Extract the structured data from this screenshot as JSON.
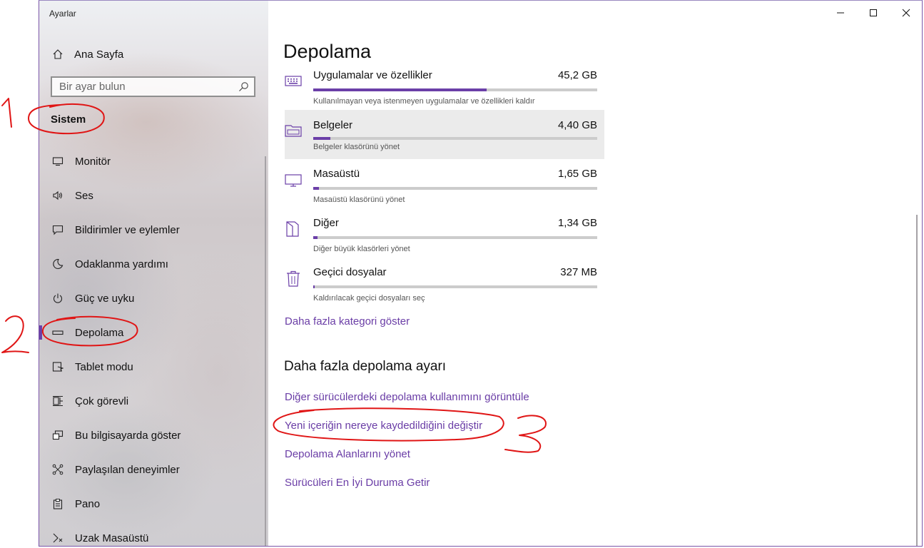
{
  "window": {
    "title": "Ayarlar"
  },
  "sidebar": {
    "home_label": "Ana Sayfa",
    "search_placeholder": "Bir ayar bulun",
    "section_heading": "Sistem",
    "items": [
      {
        "label": "Monitör",
        "icon": "monitor-icon"
      },
      {
        "label": "Ses",
        "icon": "speaker-icon"
      },
      {
        "label": "Bildirimler ve eylemler",
        "icon": "notification-icon"
      },
      {
        "label": "Odaklanma yardımı",
        "icon": "moon-icon"
      },
      {
        "label": "Güç ve uyku",
        "icon": "power-icon"
      },
      {
        "label": "Depolama",
        "icon": "storage-icon",
        "selected": true
      },
      {
        "label": "Tablet modu",
        "icon": "tablet-icon"
      },
      {
        "label": "Çok görevli",
        "icon": "multitask-icon"
      },
      {
        "label": "Bu bilgisayarda göster",
        "icon": "project-icon"
      },
      {
        "label": "Paylaşılan deneyimler",
        "icon": "share-icon"
      },
      {
        "label": "Pano",
        "icon": "clipboard-icon"
      },
      {
        "label": "Uzak Masaüstü",
        "icon": "remote-desktop-icon"
      }
    ]
  },
  "main": {
    "title": "Depolama",
    "categories": [
      {
        "name": "Uygulamalar ve özellikler",
        "size": "45,2 GB",
        "desc": "Kullanılmayan veya istenmeyen uygulamalar ve özellikleri kaldır",
        "usage": 0.61,
        "icon": "apps-icon"
      },
      {
        "name": "Belgeler",
        "size": "4,40 GB",
        "desc": "Belgeler klasörünü yönet",
        "usage": 0.06,
        "icon": "documents-folder-icon"
      },
      {
        "name": "Masaüstü",
        "size": "1,65 GB",
        "desc": "Masaüstü klasörünü yönet",
        "usage": 0.02,
        "icon": "desktop-icon"
      },
      {
        "name": "Diğer",
        "size": "1,34 GB",
        "desc": "Diğer büyük klasörleri yönet",
        "usage": 0.015,
        "icon": "other-folder-icon"
      },
      {
        "name": "Geçici dosyalar",
        "size": "327 MB",
        "desc": "Kaldırılacak geçici dosyaları seç",
        "usage": 0.005,
        "icon": "trash-icon"
      }
    ],
    "more_categories_link": "Daha fazla kategori göster",
    "more_settings_heading": "Daha fazla depolama ayarı",
    "links": [
      "Diğer sürücülerdeki depolama kullanımını görüntüle",
      "Yeni içeriğin nereye kaydedildiğini değiştir",
      "Depolama Alanlarını yönet",
      "Sürücüleri En İyi Duruma Getir"
    ]
  },
  "colors": {
    "accent": "#6b3fa8",
    "annotation": "#e01515"
  }
}
